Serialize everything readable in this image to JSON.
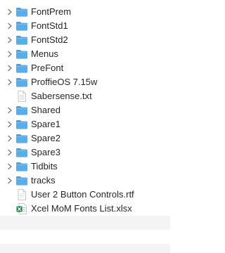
{
  "files": [
    {
      "name": "FontPrem",
      "kind": "folder",
      "expandable": true
    },
    {
      "name": "FontStd1",
      "kind": "folder",
      "expandable": true
    },
    {
      "name": "FontStd2",
      "kind": "folder",
      "expandable": true
    },
    {
      "name": "Menus",
      "kind": "folder",
      "expandable": true
    },
    {
      "name": "PreFont",
      "kind": "folder",
      "expandable": true
    },
    {
      "name": "ProffieOS 7.15w",
      "kind": "folder",
      "expandable": true
    },
    {
      "name": "Sabersense.txt",
      "kind": "text-file",
      "expandable": false
    },
    {
      "name": "Shared",
      "kind": "folder",
      "expandable": true
    },
    {
      "name": "Spare1",
      "kind": "folder",
      "expandable": true
    },
    {
      "name": "Spare2",
      "kind": "folder",
      "expandable": true
    },
    {
      "name": "Spare3",
      "kind": "folder",
      "expandable": true
    },
    {
      "name": "Tidbits",
      "kind": "folder",
      "expandable": true
    },
    {
      "name": "tracks",
      "kind": "folder",
      "expandable": true
    },
    {
      "name": "User 2 Button Controls.rtf",
      "kind": "rtf-file",
      "expandable": false
    },
    {
      "name": "Xcel MoM Fonts List.xlsx",
      "kind": "excel-file",
      "expandable": false
    }
  ],
  "colors": {
    "folder": "#5aaee8",
    "folder_tab": "#4a9fe0",
    "chevron": "#7a7a7a",
    "excel": "#1e7a45",
    "row_stripe": "#f4f4f5"
  }
}
